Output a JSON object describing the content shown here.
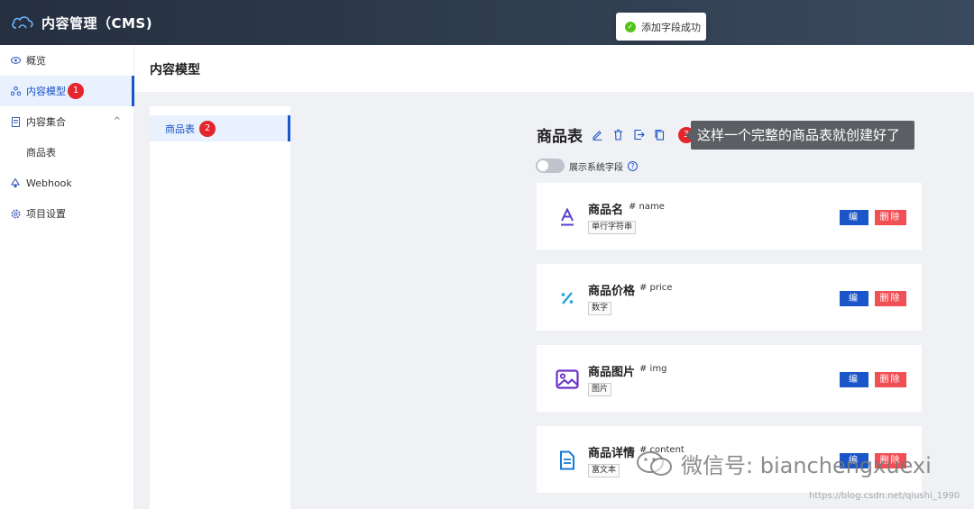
{
  "app": {
    "title": "内容管理（CMS)"
  },
  "toast": {
    "message": "添加字段成功",
    "status_color": "#52c41a"
  },
  "sidebar": {
    "items": [
      {
        "label": "概览",
        "icon": "eye-icon"
      },
      {
        "label": "内容模型",
        "icon": "model-icon",
        "badge": "1"
      },
      {
        "label": "内容集合",
        "icon": "collection-icon"
      },
      {
        "label": "商品表"
      },
      {
        "label": "Webhook",
        "icon": "webhook-icon"
      },
      {
        "label": "项目设置",
        "icon": "gear-icon"
      }
    ]
  },
  "header": {
    "title": "内容模型"
  },
  "models": {
    "items": [
      {
        "label": "商品表",
        "badge": "2"
      }
    ]
  },
  "model": {
    "name": "商品表",
    "step_badge": "3",
    "tooltip": "这样一个完整的商品表就创建好了",
    "show_system_fields_label": "展示系统字段"
  },
  "fields": [
    {
      "name": "商品名",
      "key": "# name",
      "type": "单行字符串",
      "icon": "text-icon"
    },
    {
      "name": "商品价格",
      "key": "# price",
      "type": "数字",
      "icon": "number-icon"
    },
    {
      "name": "商品图片",
      "key": "# img",
      "type": "图片",
      "icon": "image-icon"
    },
    {
      "name": "商品详情",
      "key": "# content",
      "type": "富文本",
      "icon": "document-icon"
    }
  ],
  "buttons": {
    "edit": "编辑",
    "delete": "删除"
  },
  "colors": {
    "accent": "#1a55c9",
    "danger": "#f04f55",
    "badge": "#e5242b"
  },
  "watermark": {
    "text": "微信号: bianchengxuexi",
    "url": "https://blog.csdn.net/qiushi_1990"
  }
}
